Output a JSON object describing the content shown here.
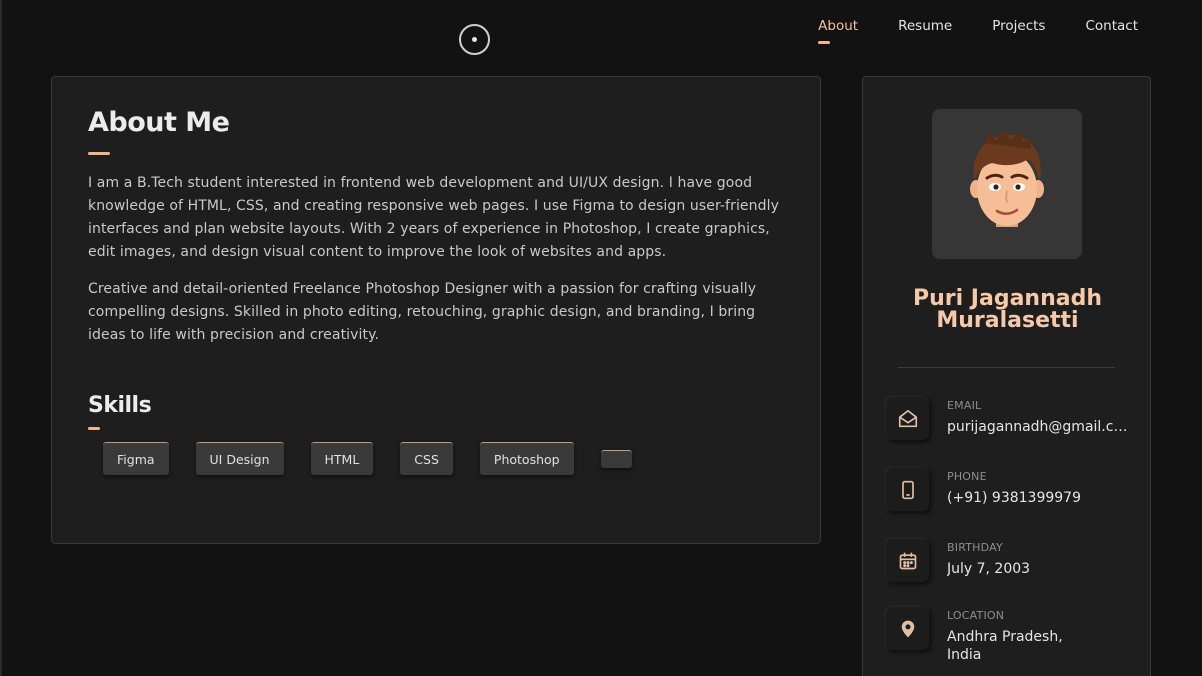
{
  "nav": {
    "items": [
      {
        "label": "About",
        "active": true
      },
      {
        "label": "Resume",
        "active": false
      },
      {
        "label": "Projects",
        "active": false
      },
      {
        "label": "Contact",
        "active": false
      }
    ]
  },
  "about": {
    "title": "About Me",
    "paragraphs": [
      "I am a B.Tech student interested in frontend web development and UI/UX design. I have good knowledge of HTML, CSS, and creating responsive web pages. I use Figma to design user-friendly interfaces and plan website layouts. With 2 years of experience in Photoshop, I create graphics, edit images, and design visual content to improve the look of websites and apps.",
      "Creative and detail-oriented Freelance Photoshop Designer with a passion for crafting visually compelling designs. Skilled in photo editing, retouching, graphic design, and branding, I bring ideas to life with precision and creativity."
    ],
    "skills_title": "Skills",
    "skills": [
      "Figma",
      "UI Design",
      "HTML",
      "CSS",
      "Photoshop",
      ""
    ]
  },
  "profile": {
    "name": "Puri Jagannadh Muralasetti",
    "contacts": [
      {
        "label": "EMAIL",
        "value": "purijagannadh@gmail.com",
        "icon": "envelope-open-icon"
      },
      {
        "label": "PHONE",
        "value": "(+91) 9381399979",
        "icon": "phone-icon"
      },
      {
        "label": "BIRTHDAY",
        "value": "July 7, 2003",
        "icon": "calendar-icon"
      },
      {
        "label": "LOCATION",
        "value": "Andhra Pradesh, India",
        "icon": "location-pin-icon"
      }
    ]
  },
  "colors": {
    "accent": "#f0b58c",
    "background": "#121212",
    "card": "#1e1e1e"
  }
}
